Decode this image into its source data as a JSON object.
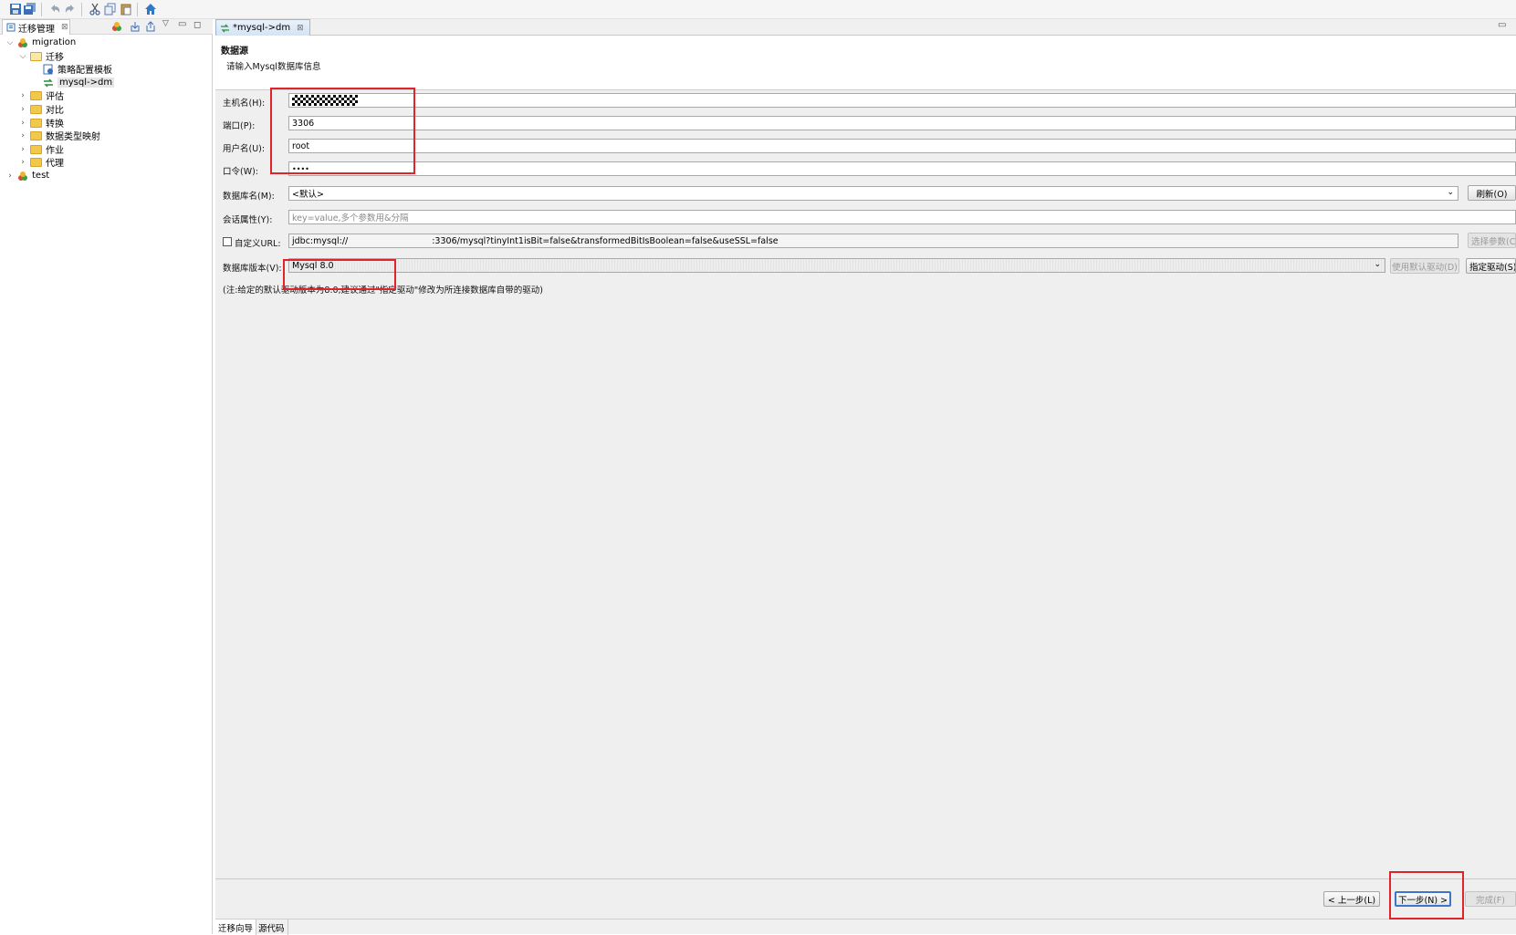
{
  "toolbar": {
    "icons": [
      "save-icon",
      "save-all-icon",
      "undo-icon",
      "redo-icon",
      "cut-icon",
      "copy-icon",
      "paste-icon",
      "home-icon"
    ]
  },
  "left_panel": {
    "tab_label": "迁移管理",
    "tree": {
      "root": "migration",
      "migrate_folder": "迁移",
      "strategy_template": "策略配置模板",
      "mysql_dm": "mysql->dm",
      "folders": [
        "评估",
        "对比",
        "转换",
        "数据类型映射",
        "作业",
        "代理"
      ],
      "second_root": "test"
    }
  },
  "editor": {
    "tab_label": "*mysql->dm",
    "header_title": "数据源",
    "header_subtitle": "请输入Mysql数据库信息",
    "form": {
      "host_label": "主机名(H):",
      "host_value": "",
      "port_label": "端口(P):",
      "port_value": "3306",
      "user_label": "用户名(U):",
      "user_value": "root",
      "password_label": "口令(W):",
      "password_value": "••••",
      "db_label": "数据库名(M):",
      "db_value": "<默认>",
      "refresh_button": "刷新(O)",
      "session_label": "会话属性(Y):",
      "session_placeholder": "key=value,多个参数用&分隔",
      "custom_url_label": "自定义URL:",
      "url_prefix": "jdbc:mysql://",
      "url_suffix": ":3306/mysql?tinyInt1isBit=false&transformedBitIsBoolean=false&useSSL=false",
      "select_params_button": "选择参数(C)",
      "version_label": "数据库版本(V):",
      "version_value": "Mysql 8.0",
      "default_driver_button": "使用默认驱动(D)",
      "specify_driver_button": "指定驱动(S)",
      "note": "(注:给定的默认驱动版本为8.0,建议通过\"指定驱动\"修改为所连接数据库自带的驱动)"
    },
    "nav": {
      "back": "< 上一步(L)",
      "next": "下一步(N) >",
      "finish": "完成(F)"
    },
    "bottom_tabs": [
      "迁移向导",
      "源代码"
    ]
  },
  "colors": {
    "highlight_red": "#e0242c",
    "tab_blue": "#d5e3f3",
    "folder_yellow": "#f3c74a"
  }
}
